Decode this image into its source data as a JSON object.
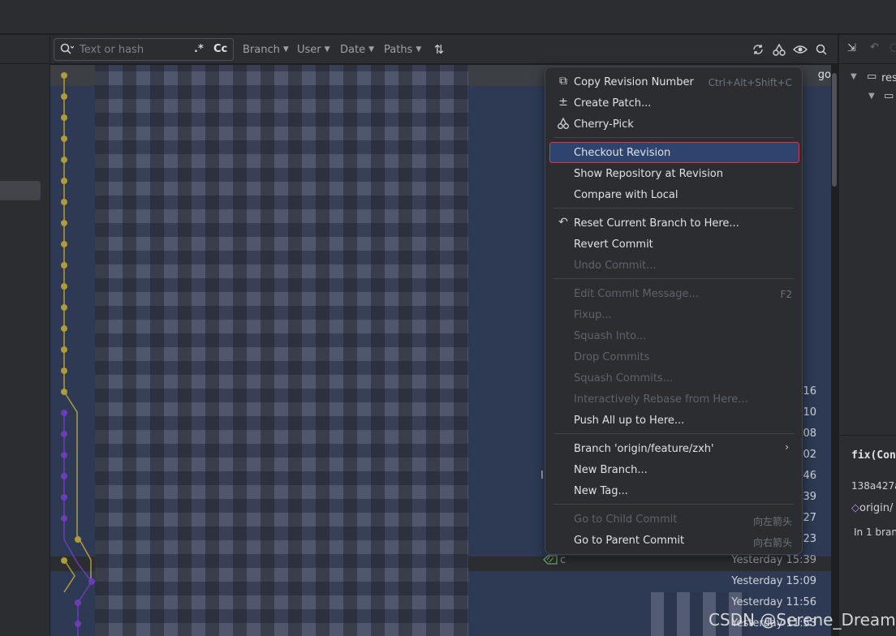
{
  "toolbar": {
    "search_placeholder": "Text or hash",
    "regex_label": ".*",
    "case_label": "Cc",
    "filters": [
      "Branch",
      "User",
      "Date",
      "Paths"
    ]
  },
  "log": {
    "first_row_suffix": "go",
    "times": [
      "16",
      "10",
      "08",
      "02",
      "46",
      "39",
      "27",
      "23",
      "Yesterday 15:39",
      "Yesterday 15:09",
      "Yesterday 11:56",
      "Yesterday 11:53"
    ],
    "row_marker": "I",
    "ref_row_text": "c"
  },
  "context_menu": {
    "copy_revision": {
      "label": "Copy Revision Number",
      "shortcut": "Ctrl+Alt+Shift+C"
    },
    "create_patch": "Create Patch...",
    "cherry_pick": "Cherry-Pick",
    "checkout_revision": "Checkout Revision",
    "show_repository": "Show Repository at Revision",
    "compare_local": "Compare with Local",
    "reset_branch": "Reset Current Branch to Here...",
    "revert_commit": "Revert Commit",
    "undo_commit": "Undo Commit...",
    "edit_message": {
      "label": "Edit Commit Message...",
      "shortcut": "F2"
    },
    "fixup": "Fixup...",
    "squash_into": "Squash Into...",
    "drop_commits": "Drop Commits",
    "squash_commits": "Squash Commits...",
    "interactive_rebase": "Interactively Rebase from Here...",
    "push_all": "Push All up to Here...",
    "branch_sub": "Branch 'origin/feature/zxh'",
    "new_branch": "New Branch...",
    "new_tag": "New Tag...",
    "go_child": {
      "label": "Go to Child Commit",
      "shortcut": "向左箭头"
    },
    "go_parent": {
      "label": "Go to Parent Commit",
      "shortcut": "向右箭头"
    }
  },
  "details": {
    "tree_label": "res",
    "commit_message": "fix(Con",
    "hash": "138a427a",
    "ref": "origin/",
    "in_branches": "In 1 bran"
  },
  "watermark": "CSDN @Serene_Dream",
  "colors": {
    "branch_main": "#b09a3b",
    "branch_feature": "#6a3db6",
    "selection": "#2e436e",
    "highlight_border": "#e0334a"
  }
}
